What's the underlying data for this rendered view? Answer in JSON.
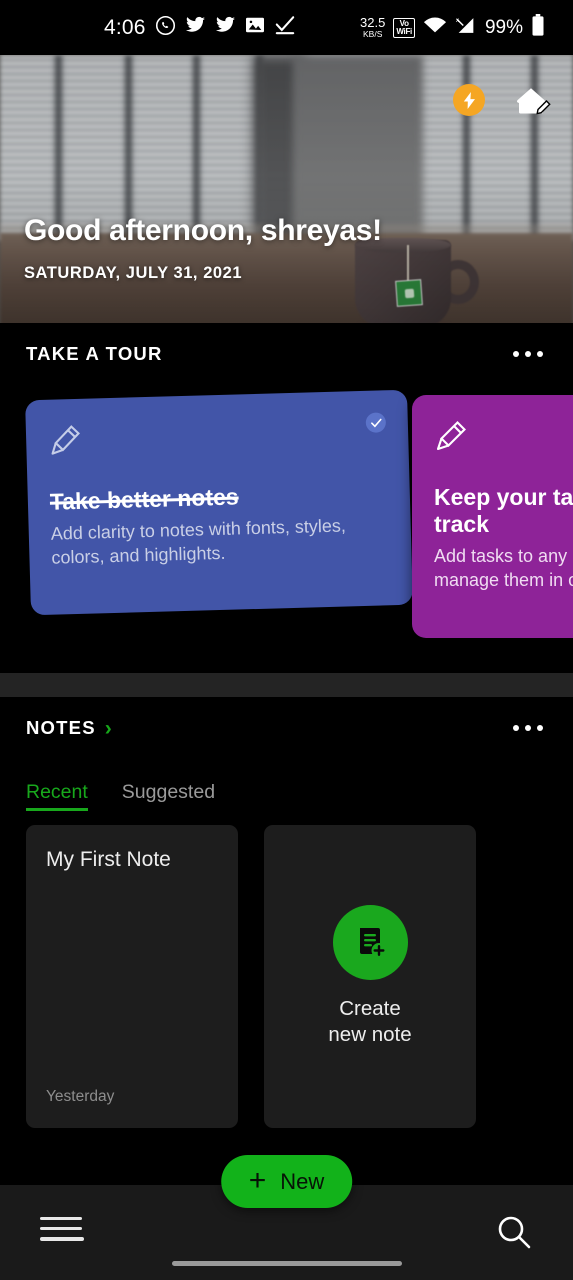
{
  "status_bar": {
    "time": "4:06",
    "app_icons": [
      "whatsapp-icon",
      "twitter-icon",
      "twitter-icon",
      "photos-icon",
      "checkmark-icon"
    ],
    "network_speed_value": "32.5",
    "network_speed_unit": "KB/S",
    "vowifi_line1": "Vo",
    "vowifi_line2": "WiFi",
    "wifi_icon": "wifi-icon",
    "signal_icon": "cellular-signal-icon",
    "battery_percent": "99%",
    "battery_icon": "battery-icon"
  },
  "hero": {
    "greeting": "Good afternoon, shreyas!",
    "date": "SATURDAY, JULY 31, 2021",
    "bolt_badge_icon": "lightning-bolt-icon",
    "home_edit_icon": "home-edit-icon",
    "background_description": "blurred office window blinds with coffee mug on desk"
  },
  "tour": {
    "section_title": "TAKE A TOUR",
    "overflow_icon": "more-options-icon",
    "cards": [
      {
        "title": "Take better notes",
        "body": "Add clarity to notes with fonts, styles, colors, and highlights.",
        "color": "#4255a8",
        "icon": "pencil-icon",
        "completed": true,
        "check_icon": "check-circle-icon"
      },
      {
        "title": "Keep your tasks on track",
        "body": "Add tasks to any note and manage them in one place.",
        "color": "#8e2398",
        "icon": "pencil-icon",
        "completed": false
      }
    ]
  },
  "notes": {
    "section_title": "NOTES",
    "chevron_icon": "chevron-right-icon",
    "overflow_icon": "more-options-icon",
    "tabs": [
      {
        "label": "Recent",
        "active": true
      },
      {
        "label": "Suggested",
        "active": false
      }
    ],
    "items": [
      {
        "title": "My First Note",
        "date": "Yesterday"
      }
    ],
    "create_card": {
      "label_line1": "Create",
      "label_line2": "new note",
      "icon": "new-note-icon"
    }
  },
  "fab": {
    "plus": "+",
    "label": "New"
  },
  "bottom_bar": {
    "menu_icon": "hamburger-menu-icon",
    "search_icon": "search-icon"
  },
  "colors": {
    "accent_green": "#12b21a",
    "tab_green": "#18a81c",
    "bolt_orange": "#f5a623",
    "card_blue": "#4255a8",
    "card_purple": "#8e2398",
    "background": "#000000",
    "surface": "#1d1d1d"
  }
}
